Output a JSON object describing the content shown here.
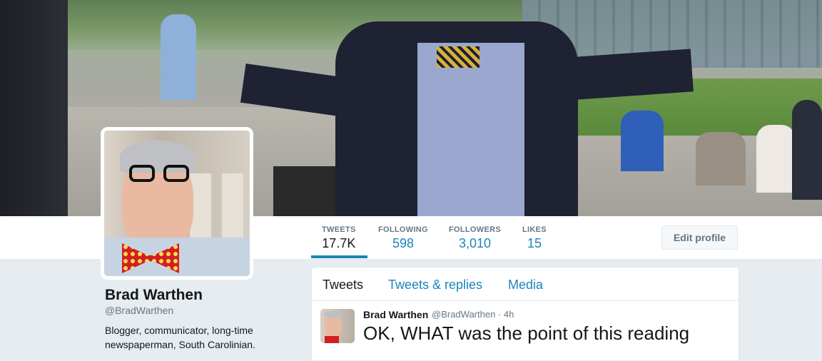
{
  "header": {
    "photo": "cover-photo"
  },
  "stats": [
    {
      "label": "TWEETS",
      "value": "17.7K"
    },
    {
      "label": "FOLLOWING",
      "value": "598"
    },
    {
      "label": "FOLLOWERS",
      "value": "3,010"
    },
    {
      "label": "LIKES",
      "value": "15"
    }
  ],
  "edit_profile_label": "Edit profile",
  "profile": {
    "name": "Brad Warthen",
    "handle": "@BradWarthen",
    "bio": "Blogger, communicator, long-time newspaperman, South Carolinian."
  },
  "timeline": {
    "tabs": [
      {
        "label": "Tweets"
      },
      {
        "label": "Tweets & replies"
      },
      {
        "label": "Media"
      }
    ],
    "tweet": {
      "name": "Brad Warthen",
      "handle": "@BradWarthen",
      "dot": "·",
      "time": "4h",
      "text": "OK, WHAT was the point of this reading"
    }
  },
  "colors": {
    "link": "#1b85b8",
    "text": "#14171a",
    "muted": "#657786",
    "background": "#e6ecf0"
  }
}
